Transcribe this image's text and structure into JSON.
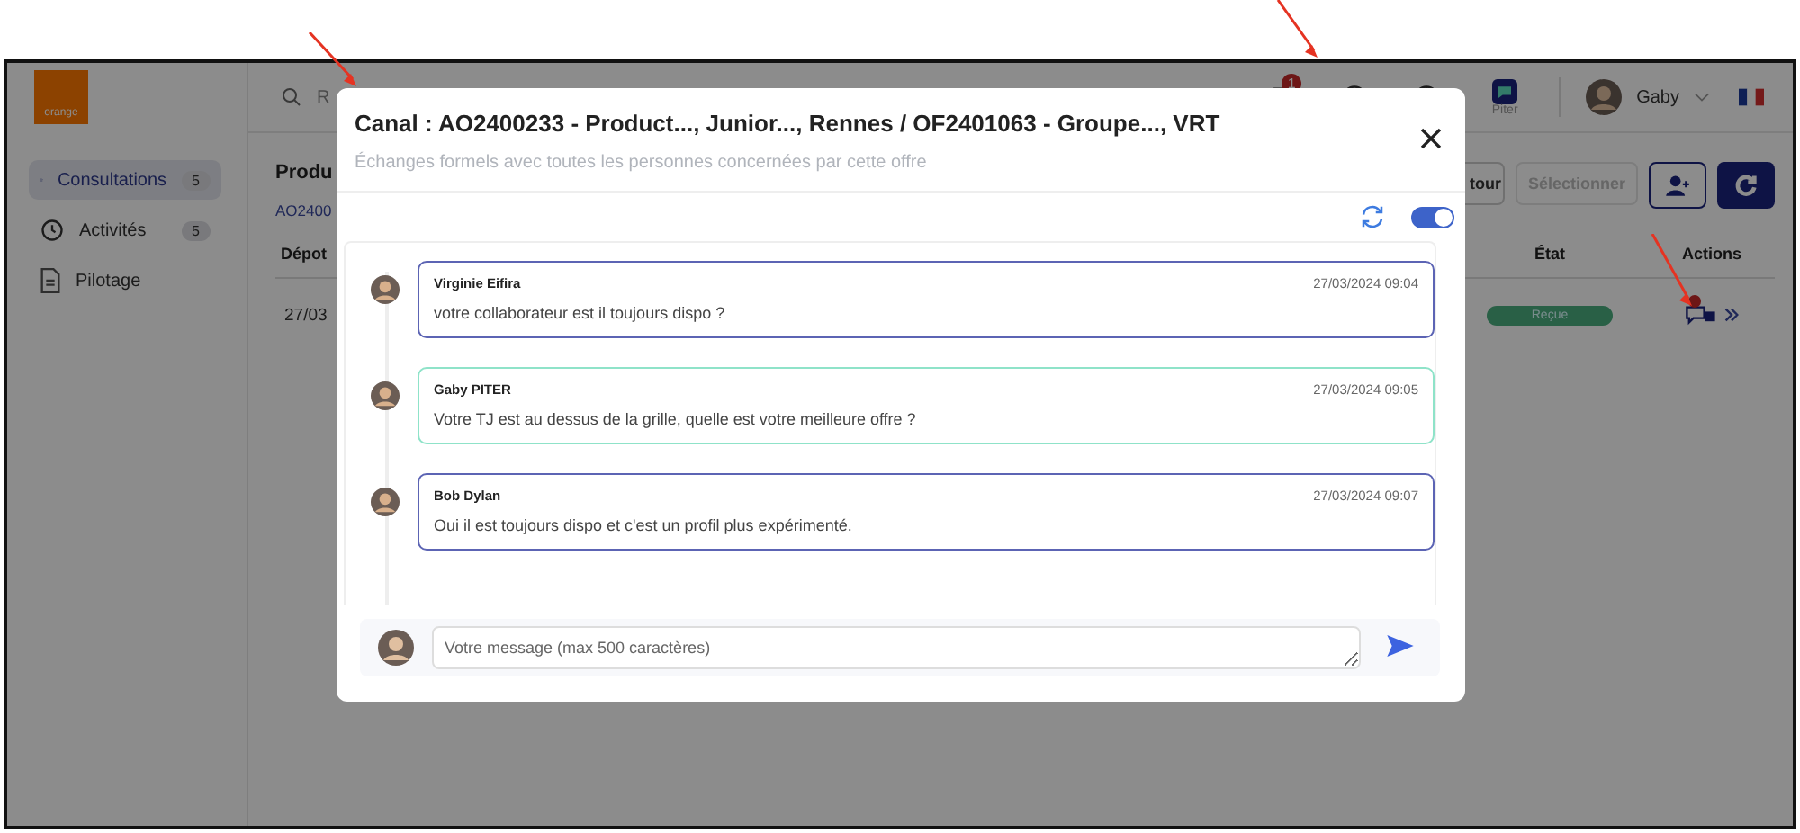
{
  "logo": {
    "text": "orange"
  },
  "sidebar": {
    "items": [
      {
        "kind": "star",
        "label": "Consultations",
        "count": "5",
        "selected": true
      },
      {
        "kind": "clock",
        "label": "Activités",
        "count": "5",
        "selected": false
      },
      {
        "kind": "document",
        "label": "Pilotage",
        "selected": false
      }
    ]
  },
  "header": {
    "search_placeholder": "R",
    "notification_count": "1",
    "app_label": "Piter",
    "user_name": "Gaby"
  },
  "page": {
    "title": "Produ",
    "link": "AO2400",
    "buttons": [
      "tour",
      "Sélectionner"
    ],
    "table": {
      "columns": [
        "Dépot",
        "État",
        "Actions"
      ],
      "rows": [
        {
          "date": "27/03",
          "status": "Reçue",
          "unread": true
        }
      ]
    }
  },
  "modal": {
    "title": "Canal : AO2400233 - Product..., Junior..., Rennes / OF2401063 - Groupe..., VRT",
    "subtitle": "Échanges formels avec toutes les personnes concernées par cette offre",
    "auto_refresh": {
      "on": true
    },
    "messages": [
      {
        "author": "Virginie Eifira",
        "time": "27/03/2024 09:04",
        "text": "votre collaborateur est il toujours dispo ?",
        "color": "#5c64b4"
      },
      {
        "author": "Gaby PITER",
        "time": "27/03/2024 09:05",
        "text": "Votre TJ est au dessus de la grille, quelle est votre meilleure offre ?",
        "color": "#8fe3c9"
      },
      {
        "author": "Bob Dylan",
        "time": "27/03/2024 09:07",
        "text": "Oui il est toujours dispo et c'est un profil plus expérimenté.",
        "color": "#5c64b4"
      }
    ],
    "composer": {
      "placeholder": "Votre message (max 500 caractères)"
    }
  }
}
